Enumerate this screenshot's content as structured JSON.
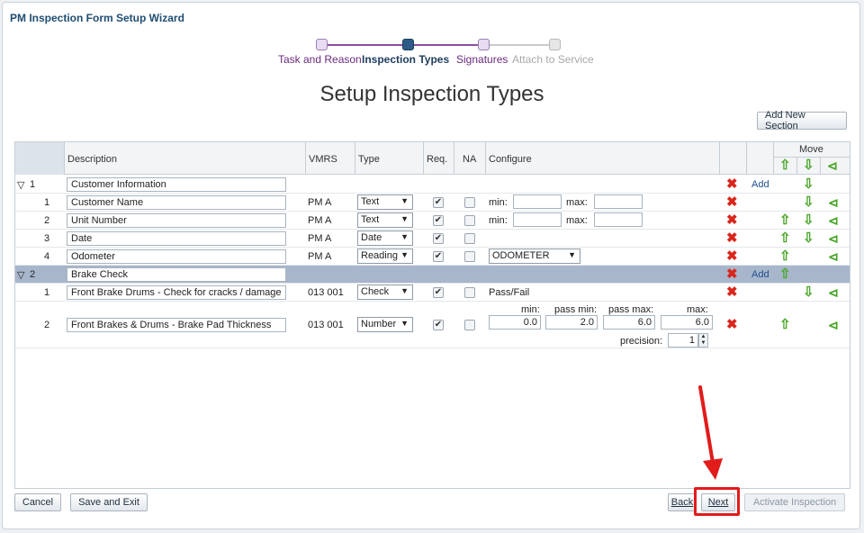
{
  "window": {
    "title": "PM Inspection Form Setup Wizard"
  },
  "wizard": {
    "steps": [
      {
        "label": "Task and Reason",
        "state": "visited"
      },
      {
        "label": "Inspection Types",
        "state": "current"
      },
      {
        "label": "Signatures",
        "state": "visited"
      },
      {
        "label": "Attach to Service",
        "state": "disabled"
      }
    ]
  },
  "page": {
    "title": "Setup Inspection Types"
  },
  "toolbar": {
    "add_section_label": "Add New Section"
  },
  "table": {
    "headers": {
      "description": "Description",
      "vmrs": "VMRS",
      "type": "Type",
      "req": "Req.",
      "na": "NA",
      "configure": "Configure",
      "move": "Move"
    },
    "sections": [
      {
        "number": "1",
        "description": "Customer Information",
        "add_label": "Add",
        "items": [
          {
            "number": "1",
            "description": "Customer Name",
            "vmrs": "PM A",
            "type": "Text",
            "req": true,
            "na": false,
            "min_label": "min:",
            "max_label": "max:"
          },
          {
            "number": "2",
            "description": "Unit Number",
            "vmrs": "PM A",
            "type": "Text",
            "req": true,
            "na": false,
            "min_label": "min:",
            "max_label": "max:"
          },
          {
            "number": "3",
            "description": "Date",
            "vmrs": "PM A",
            "type": "Date",
            "req": true,
            "na": false
          },
          {
            "number": "4",
            "description": "Odometer",
            "vmrs": "PM A",
            "type": "Reading",
            "req": true,
            "na": false,
            "configure_select": "ODOMETER"
          }
        ]
      },
      {
        "number": "2",
        "description": "Brake Check",
        "add_label": "Add",
        "items": [
          {
            "number": "1",
            "description": "Front Brake Drums - Check for cracks / damage",
            "vmrs": "013 001",
            "type": "Check",
            "req": true,
            "na": false,
            "configure_text": "Pass/Fail"
          },
          {
            "number": "2",
            "description": "Front Brakes & Drums - Brake Pad Thickness",
            "vmrs": "013 001",
            "type": "Number",
            "req": true,
            "na": false,
            "number_config": {
              "min_label": "min:",
              "pass_min_label": "pass min:",
              "pass_max_label": "pass max:",
              "max_label": "max:",
              "min": "0.0",
              "pass_min": "2.0",
              "pass_max": "6.0",
              "max": "6.0",
              "precision_label": "precision:",
              "precision": "1"
            }
          }
        ]
      }
    ]
  },
  "footer": {
    "cancel_label": "Cancel",
    "save_exit_label": "Save and Exit",
    "back_label": "Back",
    "next_label": "Next",
    "activate_label": "Activate Inspection"
  },
  "annotation": {
    "color": "#e21b1b"
  }
}
